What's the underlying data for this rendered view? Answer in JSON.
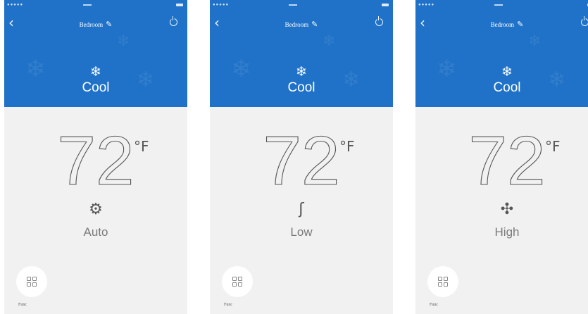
{
  "screens": [
    {
      "title": "Bedroom",
      "mode": {
        "icon": "snowflake-icon",
        "label": "Cool"
      },
      "temperature": "72",
      "unit": "°F",
      "fan": {
        "icon": "fan-auto-icon",
        "glyph": "⚙",
        "label": "Auto"
      },
      "function_label": "Func"
    },
    {
      "title": "Bedroom",
      "mode": {
        "icon": "snowflake-icon",
        "label": "Cool"
      },
      "temperature": "72",
      "unit": "°F",
      "fan": {
        "icon": "fan-low-icon",
        "glyph": "ʃ",
        "label": "Low"
      },
      "function_label": "Func"
    },
    {
      "title": "Bedroom",
      "mode": {
        "icon": "snowflake-icon",
        "label": "Cool"
      },
      "temperature": "72",
      "unit": "°F",
      "fan": {
        "icon": "fan-high-icon",
        "glyph": "✣",
        "label": "High"
      },
      "function_label": "Func"
    }
  ],
  "colors": {
    "header": "#1f72c8",
    "body": "#f1f1f1",
    "text": "#555555"
  }
}
